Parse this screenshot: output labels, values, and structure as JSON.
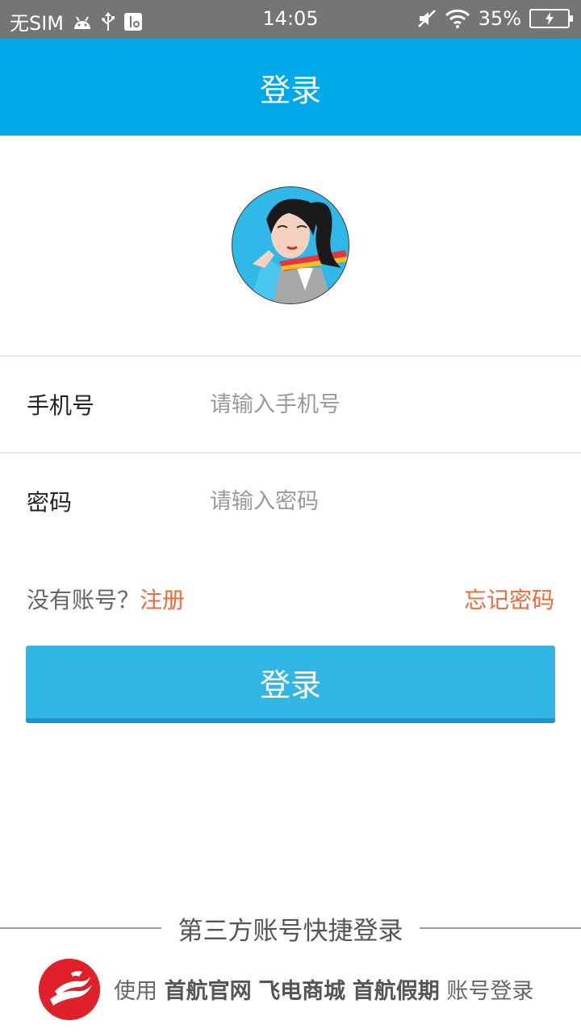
{
  "status_bar": {
    "carrier": "无SIM",
    "time": "14:05",
    "battery_percent": "35%",
    "battery_level": 0.35,
    "icons_left": [
      "android-icon",
      "usb-icon",
      "usb-debug-icon"
    ],
    "icons_right": [
      "mute-icon",
      "wifi-icon",
      "battery-icon"
    ]
  },
  "header": {
    "title": "登录"
  },
  "form": {
    "phone_label": "手机号",
    "phone_placeholder": "请输入手机号",
    "phone_value": "",
    "password_label": "密码",
    "password_placeholder": "请输入密码",
    "password_value": ""
  },
  "links": {
    "no_account_text": "没有账号？",
    "register_label": "注册",
    "forgot_label": "忘记密码"
  },
  "login_button": {
    "label": "登录"
  },
  "third_party": {
    "title": "第三方账号快捷登录",
    "prefix": "使用",
    "site1": "首航官网",
    "site2": "飞电商城",
    "site3": "首航假期",
    "suffix": "账号登录"
  },
  "colors": {
    "header_bg": "#01a9ea",
    "button_bg": "#32b6e6",
    "link": "#f26a3a",
    "status_bar_bg": "#757575",
    "logo_red": "#e0202a"
  }
}
